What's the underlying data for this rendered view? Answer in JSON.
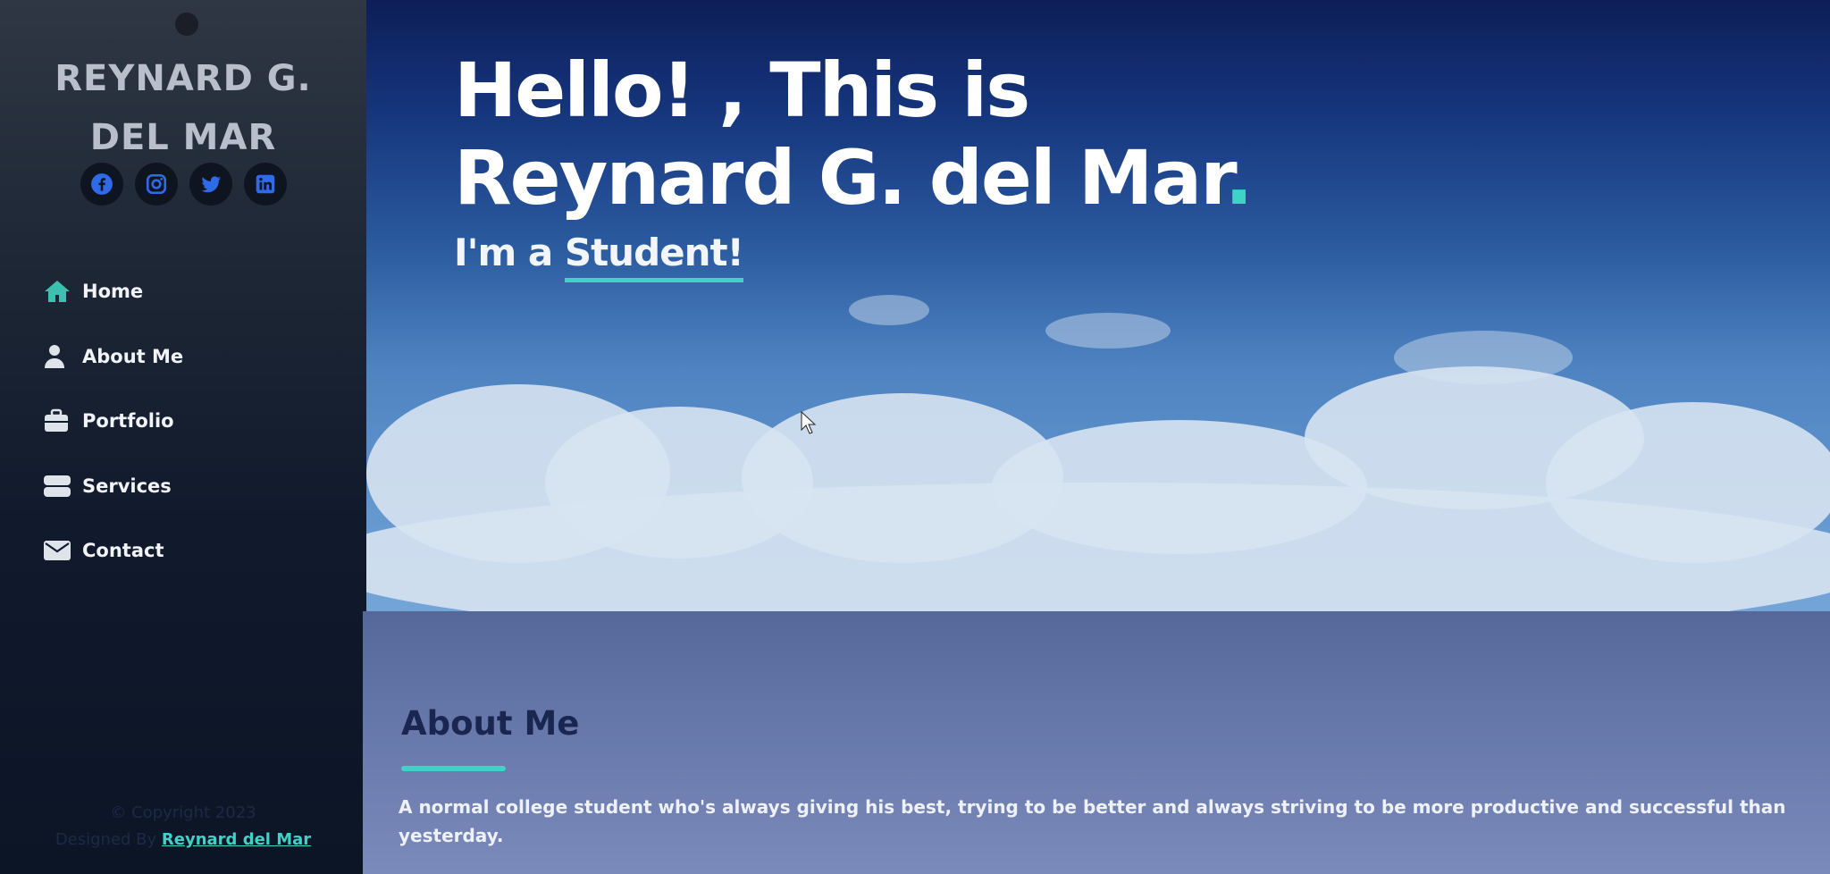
{
  "sidebar": {
    "brand_line1": "REYNARD G.",
    "brand_line2": "DEL MAR",
    "socials": [
      "facebook-icon",
      "instagram-icon",
      "twitter-icon",
      "linkedin-icon"
    ],
    "items": [
      {
        "label": "Home",
        "icon": "home-icon"
      },
      {
        "label": "About Me",
        "icon": "user-icon"
      },
      {
        "label": "Portfolio",
        "icon": "briefcase-icon"
      },
      {
        "label": "Services",
        "icon": "server-icon"
      },
      {
        "label": "Contact",
        "icon": "envelope-icon"
      }
    ],
    "footer_copyright": "© Copyright 2023",
    "footer_designed": "Designed By",
    "footer_link": "Reynard del Mar"
  },
  "hero": {
    "title_line1": "Hello! , This is",
    "title_line2": "Reynard G. del Mar",
    "title_dot": ".",
    "sub_prefix": "I'm a",
    "sub_role": "Student!"
  },
  "about": {
    "heading": "About Me",
    "text": "A normal college student who's always giving his best, trying to be better and always striving to be more productive and successful than yesterday."
  },
  "colors": {
    "accent": "#3fd2c7",
    "sidebar_bg": "#101a2c",
    "icon_blue": "#2f6be6"
  }
}
